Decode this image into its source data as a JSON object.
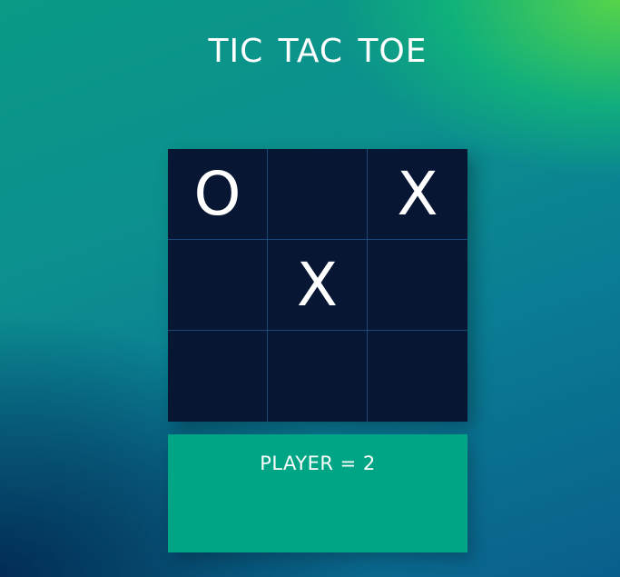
{
  "title": "TIC TAC TOE",
  "board": {
    "cells": [
      [
        "O",
        "",
        "X"
      ],
      [
        "",
        "X",
        ""
      ],
      [
        "",
        "",
        ""
      ]
    ]
  },
  "status": {
    "text": "PLAYER = 2"
  },
  "colors": {
    "board_bg": "#061633",
    "grid_line": "#1a4a7a",
    "mark": "#ffffff",
    "status_bg": "#00a585"
  }
}
